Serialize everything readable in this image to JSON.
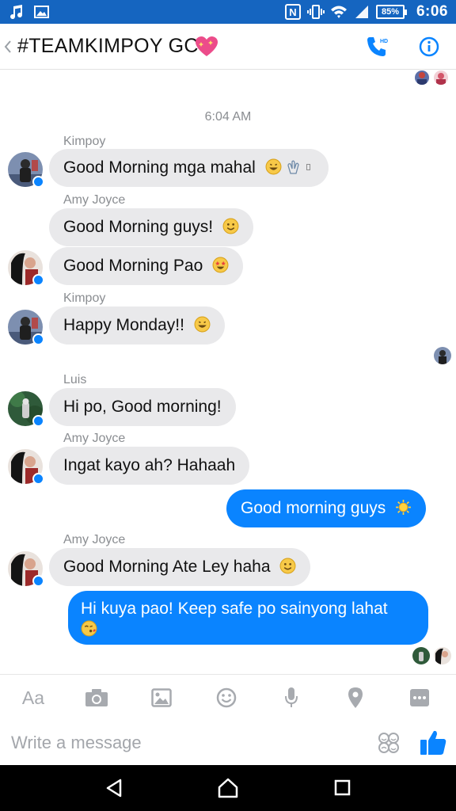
{
  "status_bar": {
    "battery": "85%",
    "time": "6:06",
    "icons": [
      "music-icon",
      "image-icon",
      "nfc-icon",
      "vibrate-icon",
      "wifi-icon",
      "signal-icon",
      "battery-icon"
    ]
  },
  "header": {
    "title": "#TEAMKIMPOY GC",
    "title_emoji": "sparkling-heart-icon",
    "back_icon": "chevron-left-icon",
    "call_icon": "hd-call-icon",
    "info_icon": "info-icon"
  },
  "messages": {
    "timestamp": "6:04 AM",
    "groups": [
      {
        "sender": "Kimpoy",
        "bubbles": [
          {
            "text": "Good Morning mga mahal",
            "emoji": "grinning-face-icon, clapping-hands-icon, unknown-glyph"
          }
        ]
      },
      {
        "sender": "Amy Joyce",
        "bubbles": [
          {
            "text": "Good Morning guys!",
            "emoji": "smiling-face-icon"
          },
          {
            "text": "Good Morning Pao",
            "emoji": "star-struck-face-icon"
          }
        ]
      },
      {
        "sender": "Kimpoy",
        "bubbles": [
          {
            "text": "Happy Monday!!",
            "emoji": "grinning-face-icon"
          }
        ]
      },
      {
        "sender": "Luis",
        "bubbles": [
          {
            "text": "Hi po, Good morning!"
          }
        ]
      },
      {
        "sender": "Amy Joyce",
        "bubbles": [
          {
            "text": "Ingat kayo ah? Hahaah"
          }
        ]
      },
      {
        "sender": "me",
        "bubbles": [
          {
            "text": "Good morning guys",
            "emoji": "sun-icon"
          }
        ]
      },
      {
        "sender": "Amy Joyce",
        "bubbles": [
          {
            "text": "Good Morning Ate Ley haha",
            "emoji": "smiling-face-icon"
          }
        ]
      },
      {
        "sender": "me",
        "bubbles": [
          {
            "text": "Hi kuya pao! Keep safe po sainyong lahat",
            "emoji": "kissing-face-icon"
          }
        ]
      }
    ]
  },
  "toolbar": {
    "text_format_label": "Aa",
    "items": [
      "camera-icon",
      "gallery-icon",
      "emoji-icon",
      "microphone-icon",
      "location-icon",
      "more-icon"
    ]
  },
  "composer": {
    "placeholder": "Write a message"
  },
  "colors": {
    "status_bar": "#1565c0",
    "accent": "#0a84ff",
    "incoming_bubble": "#e9e9eb",
    "secondary_text": "#8a8d91"
  }
}
